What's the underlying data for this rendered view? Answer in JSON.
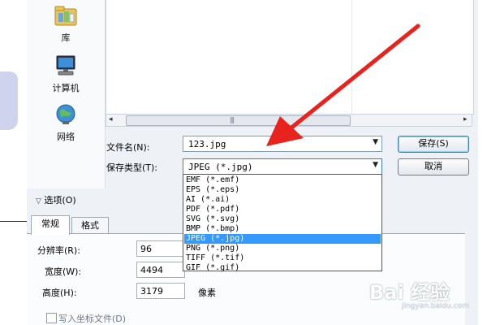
{
  "nav": {
    "items": [
      {
        "label": "库",
        "icon": "library-icon"
      },
      {
        "label": "计算机",
        "icon": "computer-icon"
      },
      {
        "label": "网络",
        "icon": "network-icon"
      }
    ]
  },
  "scrollbar": {
    "grip": "|||",
    "left_arrow": "◂",
    "right_arrow": "▸"
  },
  "filename": {
    "label": "文件名(N):",
    "value": "123.jpg"
  },
  "filetype": {
    "label": "保存类型(T):",
    "value": "JPEG (*.jpg)",
    "options": [
      "EMF (*.emf)",
      "EPS (*.eps)",
      "AI (*.ai)",
      "PDF (*.pdf)",
      "SVG (*.svg)",
      "BMP (*.bmp)",
      "JPEG (*.jpg)",
      "PNG (*.png)",
      "TIFF (*.tif)",
      "GIF (*.gif)"
    ],
    "selected_index": 6
  },
  "buttons": {
    "save": "保存(S)",
    "cancel": "取消"
  },
  "options": {
    "toggle": "选项(O)",
    "tabs": [
      "常规",
      "格式"
    ],
    "resolution": {
      "label": "分辨率(R):",
      "value": "96"
    },
    "width": {
      "label": "宽度(W):",
      "value": "4494"
    },
    "height": {
      "label": "高度(H):",
      "value": "3179",
      "unit": "像素"
    },
    "checkbox": {
      "label": "写入坐标文件(D)"
    }
  },
  "watermark": {
    "brand": "Bai 经验",
    "url": "jingyan.baidu.com"
  },
  "colors": {
    "accent": "#3399ff",
    "arrow": "#e8231e"
  }
}
